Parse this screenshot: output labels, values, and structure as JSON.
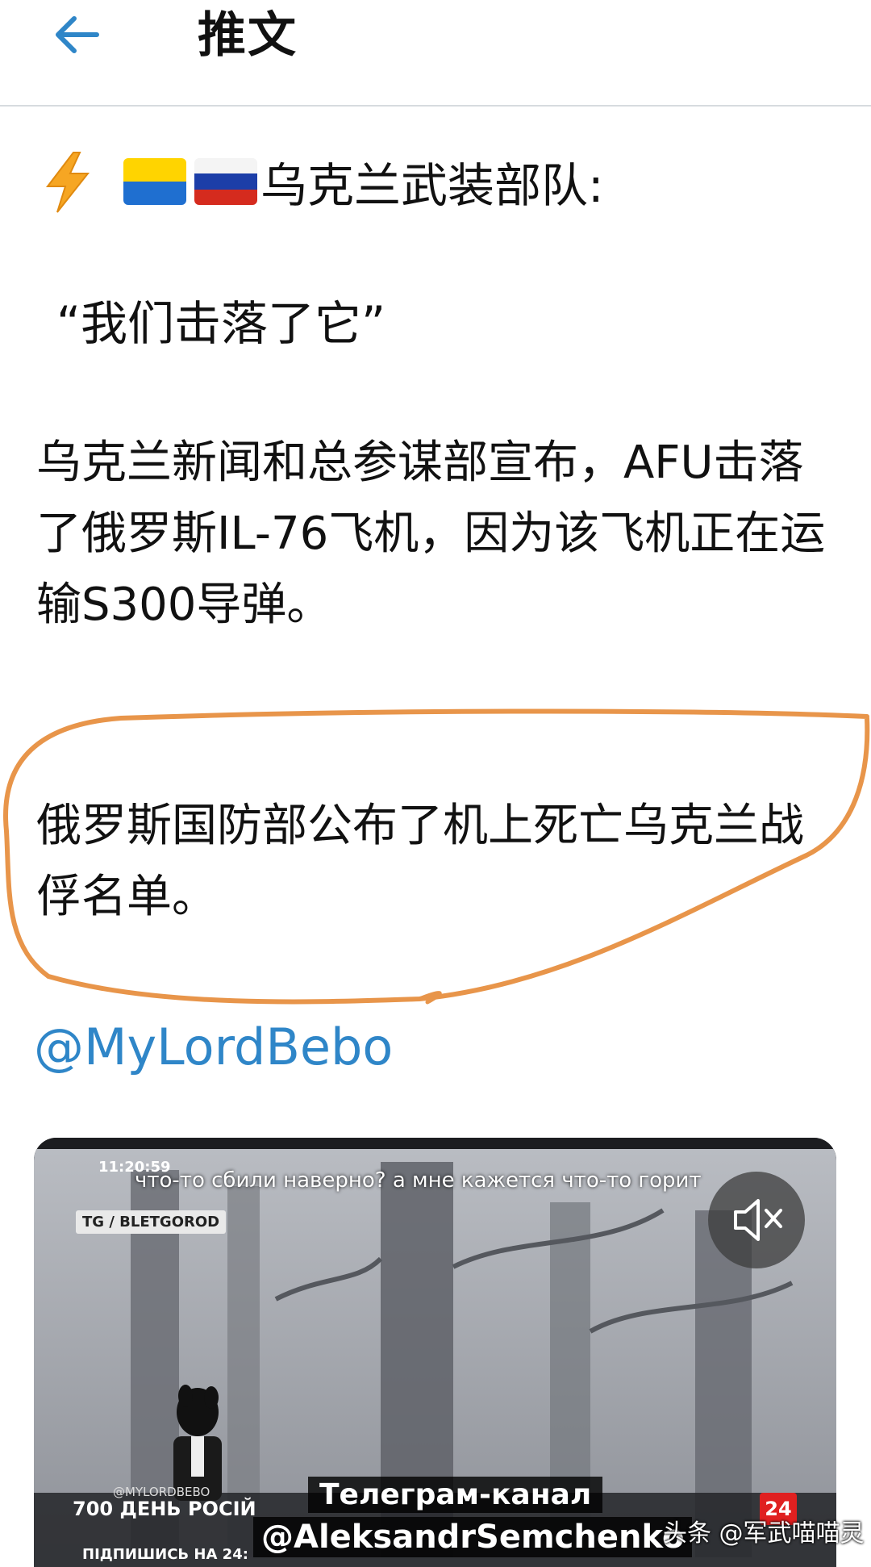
{
  "header": {
    "title": "推文"
  },
  "tweet": {
    "line1_text": "乌克兰武装部队:",
    "quote": "“我们击落了它”",
    "paragraph1": "乌克兰新闻和总参谋部宣布，AFU击落了俄罗斯IL-76飞机，因为该飞机正在运输S300导弹。",
    "paragraph2": "俄罗斯国防部公布了机上死亡乌克兰战俘名单。",
    "mention": "@MyLordBebo"
  },
  "icons": [
    "back-arrow-icon",
    "lightning-icon",
    "ukraine-flag-icon",
    "russia-flag-icon",
    "mute-icon"
  ],
  "video": {
    "timestamp": "11:20:59",
    "subtitle": "что-то сбили наверно? а мне кажется что-то горит",
    "tag": "TG / BLETGOROD",
    "watermark": "@MYLORDBEBO",
    "bottom_bar": "700 ДЕНЬ РОСІЙ",
    "telegram_line1": "Телеграм-канал",
    "telegram_line2": "@AleksandrSemchenko",
    "subscribe": "ПІДПИШИСЬ НА 24:",
    "channel_badge": "24"
  },
  "source_watermark": "头条 @军武喵喵灵",
  "colors": {
    "accent": "#2f86c8",
    "annotation": "#e8954a",
    "divider": "#d7dbdf"
  }
}
